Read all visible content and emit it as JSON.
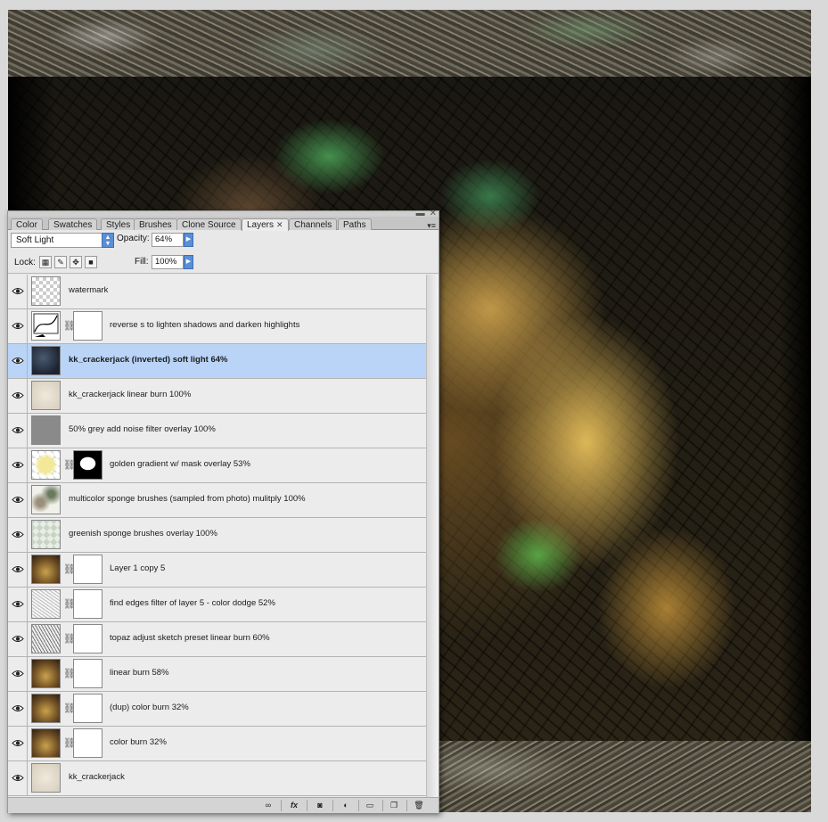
{
  "tabs": [
    {
      "label": "Color"
    },
    {
      "label": "Swatches"
    },
    {
      "label": "Styles"
    },
    {
      "label": "Brushes"
    },
    {
      "label": "Clone Source"
    },
    {
      "label": "Layers",
      "close": "✕",
      "active": true
    },
    {
      "label": "Channels"
    },
    {
      "label": "Paths"
    }
  ],
  "options": {
    "blend_mode": "Soft Light",
    "opacity_label": "Opacity:",
    "opacity_value": "64%",
    "lock_label": "Lock:",
    "fill_label": "Fill:",
    "fill_value": "100%"
  },
  "layers": [
    {
      "name": "watermark",
      "thumb": "checker",
      "mask": false,
      "selected": false
    },
    {
      "name": "reverse s to lighten shadows and darken highlights",
      "thumb": "curves-adjustment",
      "mask": true,
      "selected": false
    },
    {
      "name": "kk_crackerjack (inverted) soft light 64%",
      "thumb": "dark-texture",
      "mask": false,
      "selected": true
    },
    {
      "name": "kk_crackerjack linear burn 100%",
      "thumb": "cream-texture",
      "mask": false,
      "selected": false
    },
    {
      "name": "50% grey add noise filter overlay 100%",
      "thumb": "grey",
      "mask": false,
      "selected": false
    },
    {
      "name": "golden gradient w/ mask overlay 53%",
      "thumb": "yellow-gradient",
      "mask": true,
      "mask_style": "blob",
      "selected": false
    },
    {
      "name": "multicolor sponge brushes (sampled from photo) mulitply 100%",
      "thumb": "sponge",
      "mask": false,
      "selected": false
    },
    {
      "name": "greenish sponge brushes overlay 100%",
      "thumb": "green-checker",
      "mask": false,
      "selected": false
    },
    {
      "name": "Layer 1 copy 5",
      "thumb": "photo",
      "mask": true,
      "selected": false
    },
    {
      "name": "find edges filter of layer 5 - color dodge 52%",
      "thumb": "sketch",
      "mask": true,
      "selected": false
    },
    {
      "name": "topaz adjust sketch preset linear burn 60%",
      "thumb": "sketch-dark",
      "mask": true,
      "selected": false
    },
    {
      "name": "linear burn 58%",
      "thumb": "photo",
      "mask": true,
      "selected": false
    },
    {
      "name": "(dup) color burn 32%",
      "thumb": "photo",
      "mask": true,
      "selected": false
    },
    {
      "name": "color burn 32%",
      "thumb": "photo",
      "mask": true,
      "selected": false
    },
    {
      "name": "kk_crackerjack",
      "thumb": "cream-texture",
      "mask": false,
      "selected": false
    }
  ],
  "footer": [
    "link-layers-icon",
    "fx-icon",
    "add-mask-icon",
    "adjustment-icon",
    "new-group-icon",
    "new-layer-icon",
    "trash-icon"
  ],
  "colors": {
    "selection": "#b9d4f7",
    "accent": "#5a8fd6"
  }
}
